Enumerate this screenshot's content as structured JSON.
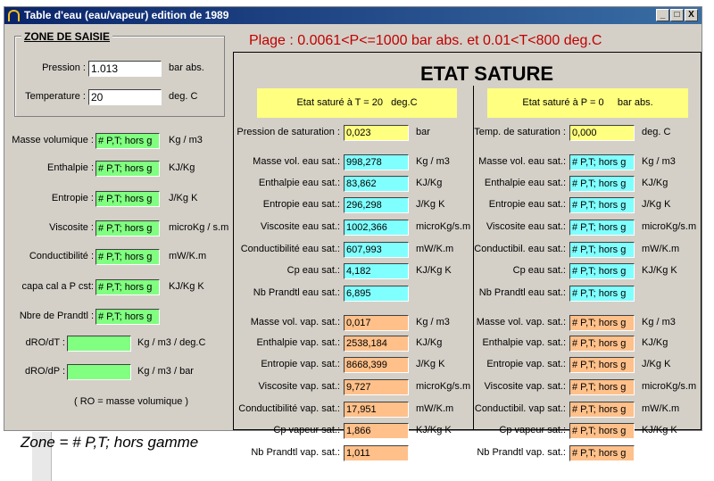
{
  "window": {
    "title": "Table d'eau  (eau/vapeur) edition de 1989",
    "min": "_",
    "max": "□",
    "close": "X"
  },
  "input_zone": {
    "title": "ZONE DE SAISIE",
    "pression": {
      "label": "Pression :",
      "value": "1.013",
      "unit": "bar abs."
    },
    "temperature": {
      "label": "Temperature :",
      "value": "20",
      "unit": "deg. C"
    }
  },
  "plage": "Plage : 0.0061<P<=1000 bar abs. et 0.01<T<800 deg.C",
  "left_props": [
    {
      "label": "Masse volumique :",
      "value": "# P,T; hors g",
      "unit": "Kg / m3"
    },
    {
      "label": "Enthalpie :",
      "value": "# P,T; hors g",
      "unit": "KJ/Kg"
    },
    {
      "label": "Entropie :",
      "value": "# P,T; hors g",
      "unit": "J/Kg K"
    },
    {
      "label": "Viscosite :",
      "value": "# P,T; hors g",
      "unit": "microKg / s.m"
    },
    {
      "label": "Conductibilité :",
      "value": "# P,T; hors g",
      "unit": "mW/K.m"
    },
    {
      "label": "capa cal a P cst:",
      "value": "# P,T; hors g",
      "unit": "KJ/Kg K"
    },
    {
      "label": "Nbre de Prandtl :",
      "value": "# P,T; hors g",
      "unit": ""
    }
  ],
  "derivs": [
    {
      "label": "dRO/dT :",
      "value": "",
      "unit": "Kg / m3 / deg.C"
    },
    {
      "label": "dRO/dP :",
      "value": "",
      "unit": "Kg / m3 / bar"
    }
  ],
  "ro_note": "( RO = masse volumique )",
  "zone_note": "Zone = # P,T; hors gamme",
  "main": {
    "title": "ETAT SATURE",
    "left": {
      "header": {
        "prefix": "Etat saturé à  T =",
        "value": "20",
        "unit": "deg.C"
      },
      "sat": {
        "label": "Pression de saturation :",
        "value": "0,023",
        "unit": "bar"
      },
      "eau": [
        {
          "label": "Masse vol. eau sat.:",
          "value": "998,278",
          "unit": "Kg / m3"
        },
        {
          "label": "Enthalpie eau sat.:",
          "value": "83,862",
          "unit": "KJ/Kg"
        },
        {
          "label": "Entropie eau sat.:",
          "value": "296,298",
          "unit": "J/Kg K"
        },
        {
          "label": "Viscosite eau sat.:",
          "value": "1002,366",
          "unit": "microKg/s.m"
        },
        {
          "label": "Conductibilité eau sat.:",
          "value": "607,993",
          "unit": "mW/K.m"
        },
        {
          "label": "Cp eau sat.:",
          "value": "4,182",
          "unit": "KJ/Kg K"
        },
        {
          "label": "Nb Prandtl eau sat.:",
          "value": "6,895",
          "unit": ""
        }
      ],
      "vap": [
        {
          "label": "Masse vol. vap. sat.:",
          "value": "0,017",
          "unit": "Kg / m3"
        },
        {
          "label": "Enthalpie vap. sat.:",
          "value": "2538,184",
          "unit": "KJ/Kg"
        },
        {
          "label": "Entropie vap. sat.:",
          "value": "8668,399",
          "unit": "J/Kg K"
        },
        {
          "label": "Viscosite vap. sat.:",
          "value": "9,727",
          "unit": "microKg/s.m"
        },
        {
          "label": "Conductibilité vap. sat.:",
          "value": "17,951",
          "unit": "mW/K.m"
        },
        {
          "label": "Cp vapeur sat.:",
          "value": "1,866",
          "unit": "KJ/Kg K"
        },
        {
          "label": "Nb Prandtl vap. sat.:",
          "value": "1,011",
          "unit": ""
        }
      ]
    },
    "right": {
      "header": {
        "prefix": "Etat saturé à  P =",
        "value": "0",
        "unit": "bar abs."
      },
      "sat": {
        "label": "Temp. de saturation :",
        "value": "0,000",
        "unit": "deg. C"
      },
      "eau": [
        {
          "label": "Masse vol. eau sat.:",
          "value": "# P,T; hors g",
          "unit": "Kg / m3"
        },
        {
          "label": "Enthalpie eau sat.:",
          "value": "# P,T; hors g",
          "unit": "KJ/Kg"
        },
        {
          "label": "Entropie eau sat.:",
          "value": "# P,T; hors g",
          "unit": "J/Kg K"
        },
        {
          "label": "Viscosite eau sat.:",
          "value": "# P,T; hors g",
          "unit": "microKg/s.m"
        },
        {
          "label": "Conductibil. eau sat.:",
          "value": "# P,T; hors g",
          "unit": "mW/K.m"
        },
        {
          "label": "Cp eau sat.:",
          "value": "# P,T; hors g",
          "unit": "KJ/Kg K"
        },
        {
          "label": "Nb Prandtl eau sat.:",
          "value": "# P,T; hors g",
          "unit": ""
        }
      ],
      "vap": [
        {
          "label": "Masse vol. vap. sat.:",
          "value": "# P,T; hors g",
          "unit": "Kg / m3"
        },
        {
          "label": "Enthalpie vap. sat.:",
          "value": "# P,T; hors g",
          "unit": "KJ/Kg"
        },
        {
          "label": "Entropie vap. sat.:",
          "value": "# P,T; hors g",
          "unit": "J/Kg K"
        },
        {
          "label": "Viscosite vap. sat.:",
          "value": "# P,T; hors g",
          "unit": "microKg/s.m"
        },
        {
          "label": "Conductibil. vap sat.:",
          "value": "# P,T; hors g",
          "unit": "mW/K.m"
        },
        {
          "label": "Cp vapeur sat.:",
          "value": "# P,T; hors g",
          "unit": "KJ/Kg K"
        },
        {
          "label": "Nb Prandtl vap. sat.:",
          "value": "# P,T; hors g",
          "unit": ""
        }
      ]
    }
  }
}
